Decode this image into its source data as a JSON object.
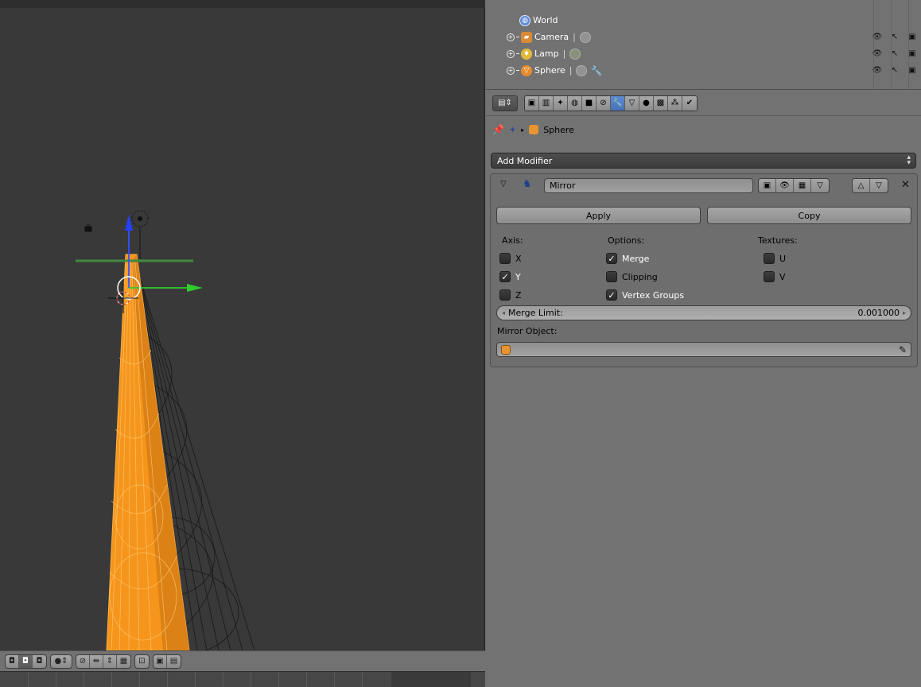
{
  "outliner": {
    "rows": [
      {
        "name": "World",
        "icon": "world-icon",
        "icon_color": "#5b8ad6"
      },
      {
        "name": "Camera",
        "icon": "camera-icon",
        "icon_color": "#d88a36"
      },
      {
        "name": "Lamp",
        "icon": "lamp-icon",
        "icon_color": "#e2b93c"
      },
      {
        "name": "Sphere",
        "icon": "mesh-icon",
        "icon_color": "#e88a2b"
      }
    ]
  },
  "properties": {
    "breadcrumb": {
      "object": "Sphere"
    },
    "add_modifier": "Add Modifier",
    "modifier": {
      "name": "Mirror",
      "apply": "Apply",
      "copy": "Copy",
      "axis": {
        "title": "Axis:",
        "x": {
          "label": "X",
          "checked": false
        },
        "y": {
          "label": "Y",
          "checked": true
        },
        "z": {
          "label": "Z",
          "checked": false
        }
      },
      "options": {
        "title": "Options:",
        "merge": {
          "label": "Merge",
          "checked": true
        },
        "clipping": {
          "label": "Clipping",
          "checked": false
        },
        "vertex_groups": {
          "label": "Vertex Groups",
          "checked": true
        }
      },
      "textures": {
        "title": "Textures:",
        "u": {
          "label": "U",
          "checked": false
        },
        "v": {
          "label": "V",
          "checked": false
        }
      },
      "merge_limit": {
        "label": "Merge Limit:",
        "value": "0.001000"
      },
      "mirror_object": {
        "label": "Mirror Object:",
        "value": ""
      }
    }
  },
  "colors": {
    "viewport_bg": "#393939",
    "panel_bg": "#727272",
    "selected_mesh": "#f5951b",
    "active_tab": "#4f7ec4"
  }
}
